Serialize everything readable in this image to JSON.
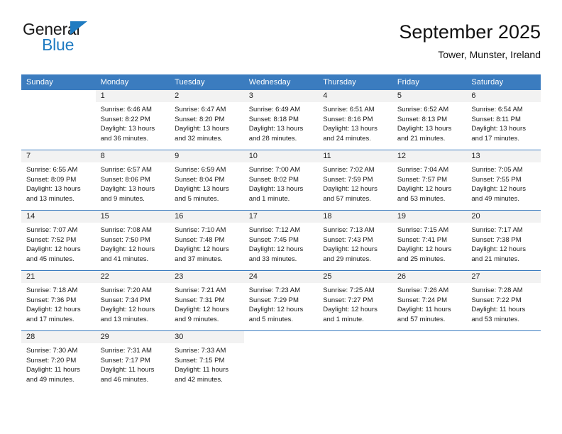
{
  "brand": {
    "name_dark": "General",
    "name_blue": "Blue",
    "logo_icon": "triangle-flag-icon",
    "accent_color": "#1f7bc1"
  },
  "header": {
    "title": "September 2025",
    "subtitle": "Tower, Munster, Ireland"
  },
  "colors": {
    "header_row_bg": "#3b7cbf",
    "daynum_band_bg": "#f2f2f2",
    "row_divider": "#3b7cbf",
    "text": "#1a1a1a"
  },
  "calendar": {
    "weekday_headers": [
      "Sunday",
      "Monday",
      "Tuesday",
      "Wednesday",
      "Thursday",
      "Friday",
      "Saturday"
    ],
    "weeks": [
      [
        {
          "day": "",
          "sunrise": "",
          "sunset": "",
          "daylight_line1": "",
          "daylight_line2": ""
        },
        {
          "day": "1",
          "sunrise": "Sunrise: 6:46 AM",
          "sunset": "Sunset: 8:22 PM",
          "daylight_line1": "Daylight: 13 hours",
          "daylight_line2": "and 36 minutes."
        },
        {
          "day": "2",
          "sunrise": "Sunrise: 6:47 AM",
          "sunset": "Sunset: 8:20 PM",
          "daylight_line1": "Daylight: 13 hours",
          "daylight_line2": "and 32 minutes."
        },
        {
          "day": "3",
          "sunrise": "Sunrise: 6:49 AM",
          "sunset": "Sunset: 8:18 PM",
          "daylight_line1": "Daylight: 13 hours",
          "daylight_line2": "and 28 minutes."
        },
        {
          "day": "4",
          "sunrise": "Sunrise: 6:51 AM",
          "sunset": "Sunset: 8:16 PM",
          "daylight_line1": "Daylight: 13 hours",
          "daylight_line2": "and 24 minutes."
        },
        {
          "day": "5",
          "sunrise": "Sunrise: 6:52 AM",
          "sunset": "Sunset: 8:13 PM",
          "daylight_line1": "Daylight: 13 hours",
          "daylight_line2": "and 21 minutes."
        },
        {
          "day": "6",
          "sunrise": "Sunrise: 6:54 AM",
          "sunset": "Sunset: 8:11 PM",
          "daylight_line1": "Daylight: 13 hours",
          "daylight_line2": "and 17 minutes."
        }
      ],
      [
        {
          "day": "7",
          "sunrise": "Sunrise: 6:55 AM",
          "sunset": "Sunset: 8:09 PM",
          "daylight_line1": "Daylight: 13 hours",
          "daylight_line2": "and 13 minutes."
        },
        {
          "day": "8",
          "sunrise": "Sunrise: 6:57 AM",
          "sunset": "Sunset: 8:06 PM",
          "daylight_line1": "Daylight: 13 hours",
          "daylight_line2": "and 9 minutes."
        },
        {
          "day": "9",
          "sunrise": "Sunrise: 6:59 AM",
          "sunset": "Sunset: 8:04 PM",
          "daylight_line1": "Daylight: 13 hours",
          "daylight_line2": "and 5 minutes."
        },
        {
          "day": "10",
          "sunrise": "Sunrise: 7:00 AM",
          "sunset": "Sunset: 8:02 PM",
          "daylight_line1": "Daylight: 13 hours",
          "daylight_line2": "and 1 minute."
        },
        {
          "day": "11",
          "sunrise": "Sunrise: 7:02 AM",
          "sunset": "Sunset: 7:59 PM",
          "daylight_line1": "Daylight: 12 hours",
          "daylight_line2": "and 57 minutes."
        },
        {
          "day": "12",
          "sunrise": "Sunrise: 7:04 AM",
          "sunset": "Sunset: 7:57 PM",
          "daylight_line1": "Daylight: 12 hours",
          "daylight_line2": "and 53 minutes."
        },
        {
          "day": "13",
          "sunrise": "Sunrise: 7:05 AM",
          "sunset": "Sunset: 7:55 PM",
          "daylight_line1": "Daylight: 12 hours",
          "daylight_line2": "and 49 minutes."
        }
      ],
      [
        {
          "day": "14",
          "sunrise": "Sunrise: 7:07 AM",
          "sunset": "Sunset: 7:52 PM",
          "daylight_line1": "Daylight: 12 hours",
          "daylight_line2": "and 45 minutes."
        },
        {
          "day": "15",
          "sunrise": "Sunrise: 7:08 AM",
          "sunset": "Sunset: 7:50 PM",
          "daylight_line1": "Daylight: 12 hours",
          "daylight_line2": "and 41 minutes."
        },
        {
          "day": "16",
          "sunrise": "Sunrise: 7:10 AM",
          "sunset": "Sunset: 7:48 PM",
          "daylight_line1": "Daylight: 12 hours",
          "daylight_line2": "and 37 minutes."
        },
        {
          "day": "17",
          "sunrise": "Sunrise: 7:12 AM",
          "sunset": "Sunset: 7:45 PM",
          "daylight_line1": "Daylight: 12 hours",
          "daylight_line2": "and 33 minutes."
        },
        {
          "day": "18",
          "sunrise": "Sunrise: 7:13 AM",
          "sunset": "Sunset: 7:43 PM",
          "daylight_line1": "Daylight: 12 hours",
          "daylight_line2": "and 29 minutes."
        },
        {
          "day": "19",
          "sunrise": "Sunrise: 7:15 AM",
          "sunset": "Sunset: 7:41 PM",
          "daylight_line1": "Daylight: 12 hours",
          "daylight_line2": "and 25 minutes."
        },
        {
          "day": "20",
          "sunrise": "Sunrise: 7:17 AM",
          "sunset": "Sunset: 7:38 PM",
          "daylight_line1": "Daylight: 12 hours",
          "daylight_line2": "and 21 minutes."
        }
      ],
      [
        {
          "day": "21",
          "sunrise": "Sunrise: 7:18 AM",
          "sunset": "Sunset: 7:36 PM",
          "daylight_line1": "Daylight: 12 hours",
          "daylight_line2": "and 17 minutes."
        },
        {
          "day": "22",
          "sunrise": "Sunrise: 7:20 AM",
          "sunset": "Sunset: 7:34 PM",
          "daylight_line1": "Daylight: 12 hours",
          "daylight_line2": "and 13 minutes."
        },
        {
          "day": "23",
          "sunrise": "Sunrise: 7:21 AM",
          "sunset": "Sunset: 7:31 PM",
          "daylight_line1": "Daylight: 12 hours",
          "daylight_line2": "and 9 minutes."
        },
        {
          "day": "24",
          "sunrise": "Sunrise: 7:23 AM",
          "sunset": "Sunset: 7:29 PM",
          "daylight_line1": "Daylight: 12 hours",
          "daylight_line2": "and 5 minutes."
        },
        {
          "day": "25",
          "sunrise": "Sunrise: 7:25 AM",
          "sunset": "Sunset: 7:27 PM",
          "daylight_line1": "Daylight: 12 hours",
          "daylight_line2": "and 1 minute."
        },
        {
          "day": "26",
          "sunrise": "Sunrise: 7:26 AM",
          "sunset": "Sunset: 7:24 PM",
          "daylight_line1": "Daylight: 11 hours",
          "daylight_line2": "and 57 minutes."
        },
        {
          "day": "27",
          "sunrise": "Sunrise: 7:28 AM",
          "sunset": "Sunset: 7:22 PM",
          "daylight_line1": "Daylight: 11 hours",
          "daylight_line2": "and 53 minutes."
        }
      ],
      [
        {
          "day": "28",
          "sunrise": "Sunrise: 7:30 AM",
          "sunset": "Sunset: 7:20 PM",
          "daylight_line1": "Daylight: 11 hours",
          "daylight_line2": "and 49 minutes."
        },
        {
          "day": "29",
          "sunrise": "Sunrise: 7:31 AM",
          "sunset": "Sunset: 7:17 PM",
          "daylight_line1": "Daylight: 11 hours",
          "daylight_line2": "and 46 minutes."
        },
        {
          "day": "30",
          "sunrise": "Sunrise: 7:33 AM",
          "sunset": "Sunset: 7:15 PM",
          "daylight_line1": "Daylight: 11 hours",
          "daylight_line2": "and 42 minutes."
        },
        {
          "day": "",
          "sunrise": "",
          "sunset": "",
          "daylight_line1": "",
          "daylight_line2": ""
        },
        {
          "day": "",
          "sunrise": "",
          "sunset": "",
          "daylight_line1": "",
          "daylight_line2": ""
        },
        {
          "day": "",
          "sunrise": "",
          "sunset": "",
          "daylight_line1": "",
          "daylight_line2": ""
        },
        {
          "day": "",
          "sunrise": "",
          "sunset": "",
          "daylight_line1": "",
          "daylight_line2": ""
        }
      ]
    ]
  }
}
